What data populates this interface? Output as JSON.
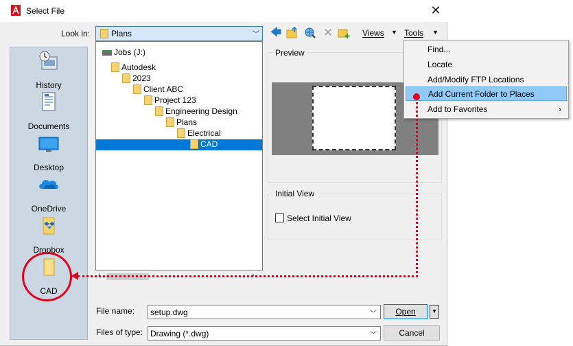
{
  "window": {
    "title": "Select File"
  },
  "toolbar": {
    "look_in_label": "Look in:",
    "look_in_value": "Plans",
    "views_label": "Views",
    "tools_label": "Tools"
  },
  "places": [
    {
      "label": "History",
      "icon": "history-icon"
    },
    {
      "label": "Documents",
      "icon": "documents-icon"
    },
    {
      "label": "Desktop",
      "icon": "desktop-icon"
    },
    {
      "label": "OneDrive",
      "icon": "onedrive-icon"
    },
    {
      "label": "Dropbox",
      "icon": "dropbox-icon"
    },
    {
      "label": "CAD",
      "icon": "folder-icon"
    }
  ],
  "tree": [
    {
      "label": "Jobs (J:)",
      "icon": "drive-icon"
    },
    {
      "label": "Autodesk",
      "icon": "folder-icon"
    },
    {
      "label": "2023",
      "icon": "folder-icon"
    },
    {
      "label": "Client ABC",
      "icon": "folder-icon"
    },
    {
      "label": "Project 123",
      "icon": "folder-icon"
    },
    {
      "label": "Engineering Design",
      "icon": "folder-icon"
    },
    {
      "label": "Plans",
      "icon": "folder-icon"
    },
    {
      "label": "Electrical",
      "icon": "folder-icon"
    },
    {
      "label": "CAD",
      "icon": "folder-icon",
      "selected": true
    }
  ],
  "preview": {
    "title": "Preview"
  },
  "initial_view": {
    "title": "Initial View",
    "checkbox_label": "Select Initial View"
  },
  "file_name": {
    "label": "File name:",
    "value": "setup.dwg"
  },
  "file_type": {
    "label": "Files of type:",
    "value": "Drawing (*.dwg)"
  },
  "buttons": {
    "open": "Open",
    "cancel": "Cancel"
  },
  "tools_menu": [
    {
      "label": "Find..."
    },
    {
      "label": "Locate"
    },
    {
      "label": "Add/Modify FTP Locations"
    },
    {
      "label": "Add Current Folder to Places",
      "highlighted": true
    },
    {
      "label": "Add to Favorites",
      "submenu": true
    }
  ],
  "colors": {
    "annotation": "#e3001b",
    "selection": "#0078d7",
    "highlight": "#91c9f7"
  }
}
